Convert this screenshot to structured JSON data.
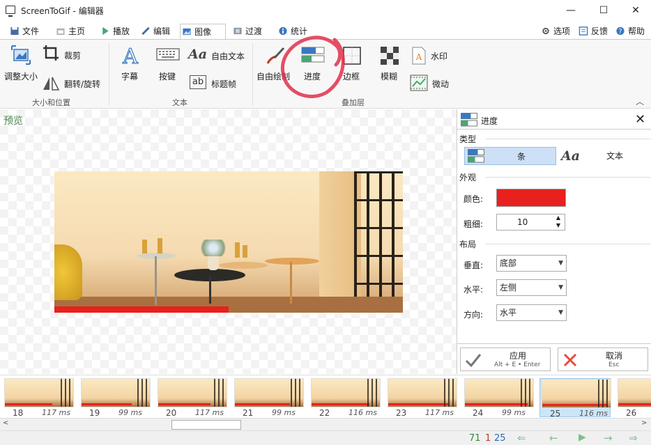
{
  "window": {
    "title": "ScreenToGif - 编辑器",
    "minimize": "—",
    "maximize": "☐",
    "close": "✕"
  },
  "tabs": [
    {
      "label": "文件",
      "icon": "save-icon"
    },
    {
      "label": "主页",
      "icon": "home-icon"
    },
    {
      "label": "播放",
      "icon": "play-icon"
    },
    {
      "label": "编辑",
      "icon": "pencil-icon"
    },
    {
      "label": "图像",
      "icon": "image-icon",
      "active": true
    },
    {
      "label": "过渡",
      "icon": "transition-icon"
    },
    {
      "label": "统计",
      "icon": "info-icon"
    }
  ],
  "menu_right": {
    "options": "选项",
    "feedback": "反馈",
    "help": "帮助"
  },
  "ribbon": {
    "size_group": {
      "resize": "调整大小",
      "crop": "裁剪",
      "flip_rotate": "翻转/旋转",
      "label": "大小和位置"
    },
    "text_group": {
      "caption": "字幕",
      "keystrokes": "按键",
      "free_text": "自由文本",
      "title_frame": "标题帧",
      "label": "文本"
    },
    "overlay_group": {
      "free_drawing": "自由绘制",
      "progress": "进度",
      "border": "边框",
      "blur": "模糊",
      "watermark": "水印",
      "cinemagraph": "微动",
      "label": "叠加层"
    }
  },
  "preview": {
    "label": "预览",
    "progress_fraction": 0.5
  },
  "panel": {
    "title": "进度",
    "type_section": "类型",
    "type_bar": "条",
    "type_text": "文本",
    "appearance_section": "外观",
    "color_label": "颜色:",
    "color_value": "#e8211f",
    "thickness_label": "粗细:",
    "thickness_value": "10",
    "layout_section": "布局",
    "vertical_label": "垂直:",
    "vertical_value": "底部",
    "horizontal_label": "水平:",
    "horizontal_value": "左侧",
    "direction_label": "方向:",
    "direction_value": "水平",
    "apply": "应用",
    "apply_shortcut": "Alt + E • Enter",
    "cancel": "取消",
    "cancel_shortcut": "Esc"
  },
  "frames": [
    {
      "num": "18",
      "ms": "117 ms",
      "progress": 0.69
    },
    {
      "num": "19",
      "ms": "99 ms",
      "progress": 0.73
    },
    {
      "num": "20",
      "ms": "117 ms",
      "progress": 0.77
    },
    {
      "num": "21",
      "ms": "99 ms",
      "progress": 0.81
    },
    {
      "num": "22",
      "ms": "116 ms",
      "progress": 0.85
    },
    {
      "num": "23",
      "ms": "117 ms",
      "progress": 0.88
    },
    {
      "num": "24",
      "ms": "99 ms",
      "progress": 0.92
    },
    {
      "num": "25",
      "ms": "116 ms",
      "progress": 0.96,
      "selected": true
    },
    {
      "num": "26",
      "ms": "",
      "progress": 1.0
    }
  ],
  "status": {
    "total": "71",
    "selected": "1",
    "current": "25"
  },
  "colors": {
    "accent": "#4f8a55",
    "progress": "#e8211f",
    "selection": "#cde5f7"
  }
}
